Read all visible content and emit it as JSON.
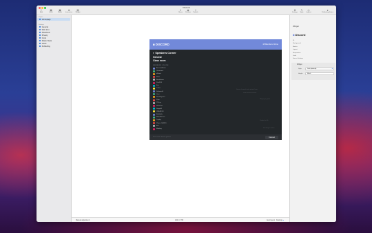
{
  "window": {
    "title": "Discord"
  },
  "toolbar": {
    "left": [
      {
        "label": "Add",
        "icon": "plus-icon"
      },
      {
        "label": "Insert",
        "icon": "insert-icon"
      },
      {
        "label": "Media",
        "icon": "media-icon"
      },
      {
        "label": "Interactive",
        "icon": "interactive-icon"
      },
      {
        "label": "Widget",
        "icon": "widget-icon"
      }
    ],
    "center": [
      {
        "label": "Share",
        "icon": "share-icon"
      },
      {
        "label": "Preview",
        "icon": "preview-icon"
      },
      {
        "label": "Publish",
        "icon": "publish-icon"
      }
    ],
    "right": [
      {
        "label": "Settings",
        "icon": "gear-icon"
      },
      {
        "label": "Style",
        "icon": "brush-icon"
      },
      {
        "label": "Inspect",
        "icon": "eye-icon"
      },
      {
        "label": "Publishing Status",
        "icon": "status-icon"
      }
    ],
    "publish_status": "Publishing Status",
    "publish_btn": "Publish"
  },
  "sidebar": {
    "header_pages": "Pages",
    "pages": [
      {
        "label": "Homepage",
        "selected": true
      }
    ],
    "header_settings": "Settings",
    "settings": [
      {
        "label": "General"
      },
      {
        "label": "Web Icon"
      },
      {
        "label": "Advanced"
      },
      {
        "label": "Privacy"
      },
      {
        "label": "Code"
      },
      {
        "label": "Master Style"
      },
      {
        "label": "Hosts"
      },
      {
        "label": "Publishing"
      }
    ]
  },
  "widget": {
    "brand": "DISCORD",
    "online": "48 Members Online",
    "server": "Speakers Corner",
    "channels": [
      "General",
      "Class room"
    ],
    "section": "MEMBERS ONLINE",
    "members": [
      "AccountName",
      "Username",
      "aBeast",
      "Moot",
      "Bookslover",
      "Paul123",
      "Erin",
      "Lukas",
      "SoftwareB",
      "Yeet",
      "StarPlayer12",
      "Pixie",
      "IT Guy",
      "WhiteFox",
      "SimpleX",
      "CREATOR",
      "Buildable",
      "MoonBanner",
      "Trophy",
      "Player GAMES",
      "Ace",
      "Monkey"
    ],
    "ghost_lines": [
      "Some channel text content here",
      "some more text text",
      "Playing a game",
      "Online for 4h",
      "listening to music"
    ],
    "hint": "Free voice chat for gamers",
    "join": "Connect"
  },
  "inspector": {
    "title": "Discord",
    "section": "Widget",
    "fields": [
      "ID",
      "Background",
      "Border",
      "Layout",
      "Responsive",
      "Links",
      "Server Settings"
    ],
    "style_label": "Style",
    "style_value": "Dark (default)",
    "height_label": "Height",
    "height_value": "Block"
  },
  "statusbar": {
    "left": "Manual adjustment",
    "center": "1024 × 768",
    "right_label": "Auto layout",
    "right_value": "Desktop"
  },
  "colors": {
    "discord": "#7289da",
    "accent": "#3a7fe0",
    "widget_bg": "#23272a"
  }
}
